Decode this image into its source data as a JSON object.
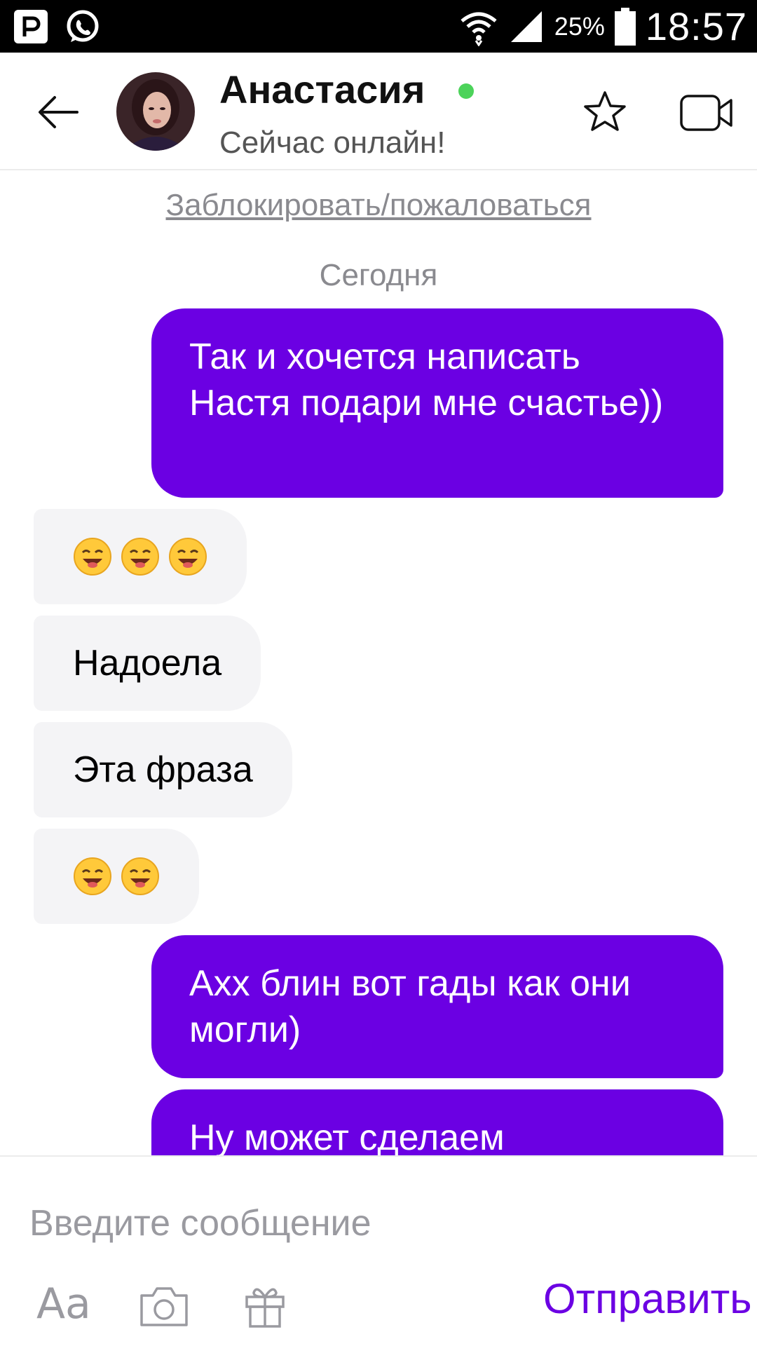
{
  "status_bar": {
    "battery_percent": "25%",
    "time": "18:57",
    "icons": [
      "p-app-icon",
      "whatsapp-icon",
      "wifi-icon",
      "signal-icon",
      "battery-icon"
    ]
  },
  "header": {
    "contact_name": "Анастасия",
    "status": "Сейчас онлайн!",
    "online_color": "#4cd35a"
  },
  "chat": {
    "block_link": "Заблокировать/пожаловаться",
    "date_separator": "Сегодня",
    "messages": [
      {
        "direction": "out",
        "text": "Так и хочется написать Настя подари мне счастье))"
      },
      {
        "direction": "in",
        "emoji": [
          "grinning-face-icon",
          "grinning-face-icon",
          "grinning-face-icon"
        ]
      },
      {
        "direction": "in",
        "text": "Надоела"
      },
      {
        "direction": "in",
        "text": "Эта фраза"
      },
      {
        "direction": "in",
        "emoji": [
          "grinning-face-icon",
          "grinning-face-icon"
        ]
      },
      {
        "direction": "out",
        "text": "Ахх блин вот гады как они могли)"
      },
      {
        "direction": "out",
        "text": "Ну может сделаем"
      }
    ]
  },
  "composer": {
    "placeholder": "Введите сообщение",
    "text_format_label": "Aa",
    "send_label": "Отправить"
  },
  "colors": {
    "accent": "#6b00e3",
    "incoming_bubble": "#f4f4f6",
    "status_bar": "#000000"
  }
}
